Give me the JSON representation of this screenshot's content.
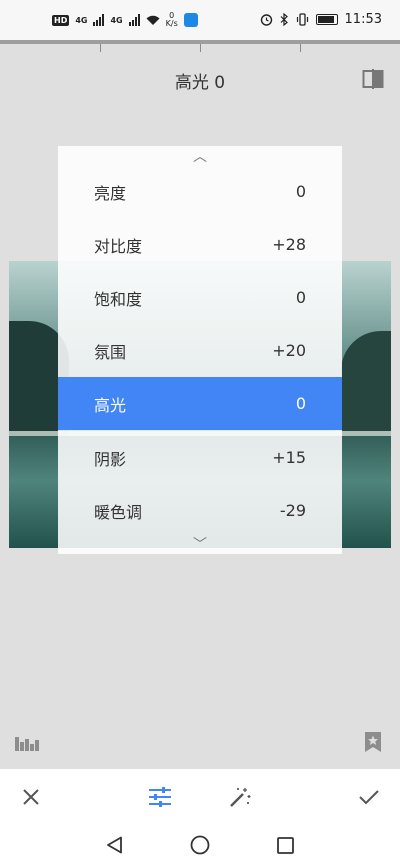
{
  "status_bar": {
    "network_badge": "HD",
    "network_badge_2": "4G",
    "network_badge_3": "4G",
    "speed_value": "0",
    "speed_unit": "K/s",
    "time": "11:53"
  },
  "header": {
    "title": "高光 0"
  },
  "adjust_menu": {
    "items": [
      {
        "label": "亮度",
        "value": "0"
      },
      {
        "label": "对比度",
        "value": "+28"
      },
      {
        "label": "饱和度",
        "value": "0"
      },
      {
        "label": "氛围",
        "value": "+20"
      },
      {
        "label": "高光",
        "value": "0"
      },
      {
        "label": "阴影",
        "value": "+15"
      },
      {
        "label": "暖色调",
        "value": "-29"
      }
    ],
    "selected_index": 4,
    "accent_color": "#4285f4"
  },
  "toolbar": {
    "icons": [
      "close-icon",
      "tune-sliders-icon",
      "magic-wand-icon",
      "checkmark-icon"
    ],
    "active_color": "#4285f4"
  },
  "navigation": {
    "icons": [
      "back-icon",
      "home-icon",
      "recents-icon"
    ]
  }
}
